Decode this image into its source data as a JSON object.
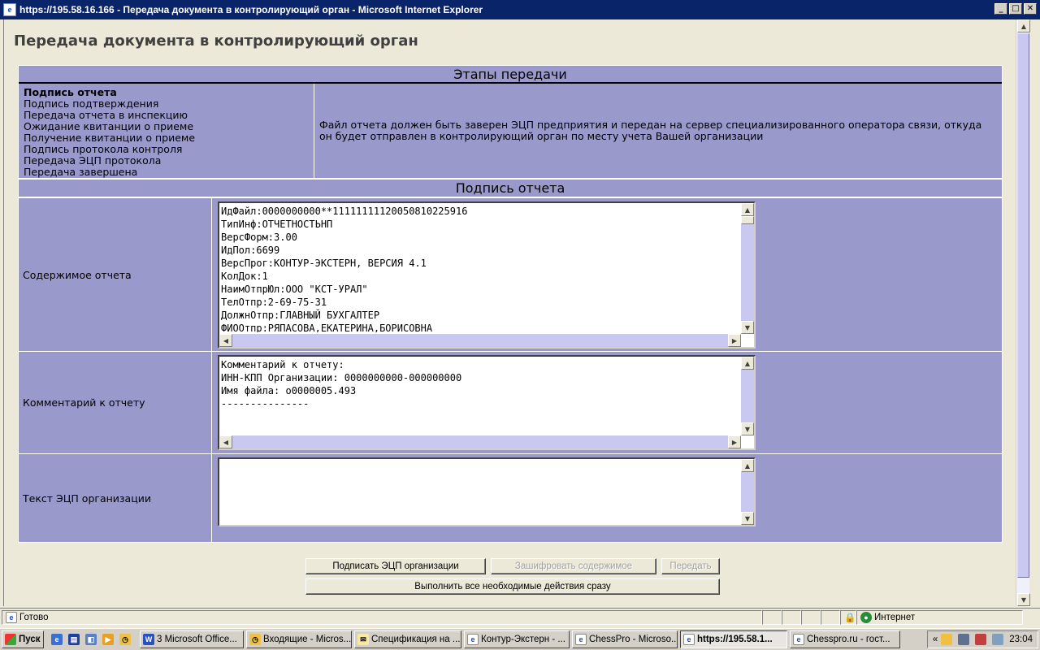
{
  "window": {
    "title": "https://195.58.16.166 - Передача документа в контролирующий орган - Microsoft Internet Explorer",
    "min_label": "_",
    "max_label": "□",
    "close_label": "✕"
  },
  "page": {
    "title": "Передача документа в контролирующий орган"
  },
  "stages": {
    "header": "Этапы передачи",
    "items": [
      "Подпись отчета",
      "Подпись подтверждения",
      "Передача отчета в инспекцию",
      "Ожидание квитанции о приеме",
      "Получение квитанции о приеме",
      "Подпись протокола контроля",
      "Передача ЭЦП протокола",
      "Передача завершена"
    ],
    "active_index": 0,
    "description": "Файл отчета должен быть заверен ЭЦП предприятия и передан на сервер специализированного оператора связи, откуда он будет отправлен в контролирующий орган по месту учета Вашей организации"
  },
  "sign": {
    "header": "Подпись отчета",
    "content_label": "Содержимое отчета",
    "content_text": "ИдФайл:0000000000**11111111120050810225916\nТипИнф:ОТЧЕТНОСТЬНП\nВерсФорм:3.00\nИдПол:6699\nВерсПрог:КОНТУР-ЭКСТЕРН, ВЕРСИЯ 4.1\nКолДок:1\nНаимОтпрЮл:ООО \"КСТ-УРАЛ\"\nТелОтпр:2-69-75-31\nДолжнОтпр:ГЛАВНЫЙ БУХГАЛТЕР\nФИООтпр:РЯПАСОВА,ЕКАТЕРИНА,БОРИСОВНА",
    "comment_label": "Комментарий к отчету",
    "comment_text": "Комментарий к отчету:\nИНН-КПП Организации: 0000000000-000000000\nИмя файла: o0000005.493\n---------------",
    "ecp_label": "Текст ЭЦП организации",
    "ecp_text": ""
  },
  "buttons": {
    "sign": "Подписать ЭЦП организации",
    "encrypt": "Зашифровать содержимое",
    "send": "Передать",
    "do_all": "Выполнить все необходимые действия сразу"
  },
  "statusbar": {
    "status": "Готово",
    "zone": "Интернет"
  },
  "taskbar": {
    "start": "Пуск",
    "items": [
      {
        "label": "3 Microsoft Office...",
        "icon": "word-icon",
        "active": false
      },
      {
        "label": "Входящие - Micros...",
        "icon": "outlook-icon",
        "active": false
      },
      {
        "label": "Спецификация на ...",
        "icon": "mail-icon",
        "active": false
      },
      {
        "label": "Контур-Экстерн - ...",
        "icon": "ie-icon",
        "active": false
      },
      {
        "label": "ChessPro - Microso...",
        "icon": "ie-icon",
        "active": false
      },
      {
        "label": "https://195.58.1...",
        "icon": "ie-icon",
        "active": true
      },
      {
        "label": "Chesspro.ru - гост...",
        "icon": "ie-icon",
        "active": false
      }
    ],
    "clock": "23:04",
    "tray_expand": "«"
  },
  "colors": {
    "panel": "#9999cc",
    "scroll": "#c8c8f0",
    "titlebar": "#0a246a"
  }
}
